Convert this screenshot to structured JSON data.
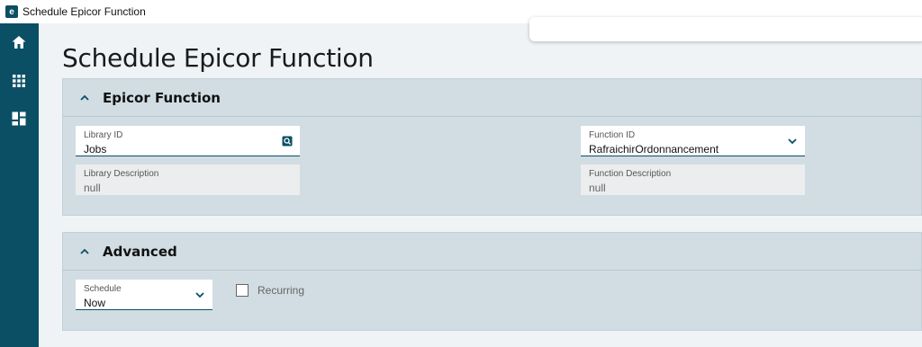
{
  "window": {
    "title": "Schedule Epicor Function",
    "logo_letter": "e"
  },
  "sidebar": {
    "items": [
      {
        "name": "home",
        "icon": "home-icon"
      },
      {
        "name": "apps",
        "icon": "grid-icon"
      },
      {
        "name": "dashboard",
        "icon": "dashboard-icon"
      }
    ]
  },
  "page": {
    "title": "Schedule Epicor Function"
  },
  "epicor_function": {
    "title": "Epicor Function",
    "library_id": {
      "label": "Library ID",
      "value": "Jobs"
    },
    "function_id": {
      "label": "Function ID",
      "value": "RafraichirOrdonnancement"
    },
    "library_description": {
      "label": "Library Description",
      "value": "null"
    },
    "function_description": {
      "label": "Function Description",
      "value": "null"
    }
  },
  "advanced": {
    "title": "Advanced",
    "schedule": {
      "label": "Schedule",
      "value": "Now"
    },
    "recurring": {
      "label": "Recurring",
      "checked": false
    }
  },
  "colors": {
    "accent": "#0b4f64",
    "panel": "#d1dde3",
    "background": "#f0f3f6"
  }
}
